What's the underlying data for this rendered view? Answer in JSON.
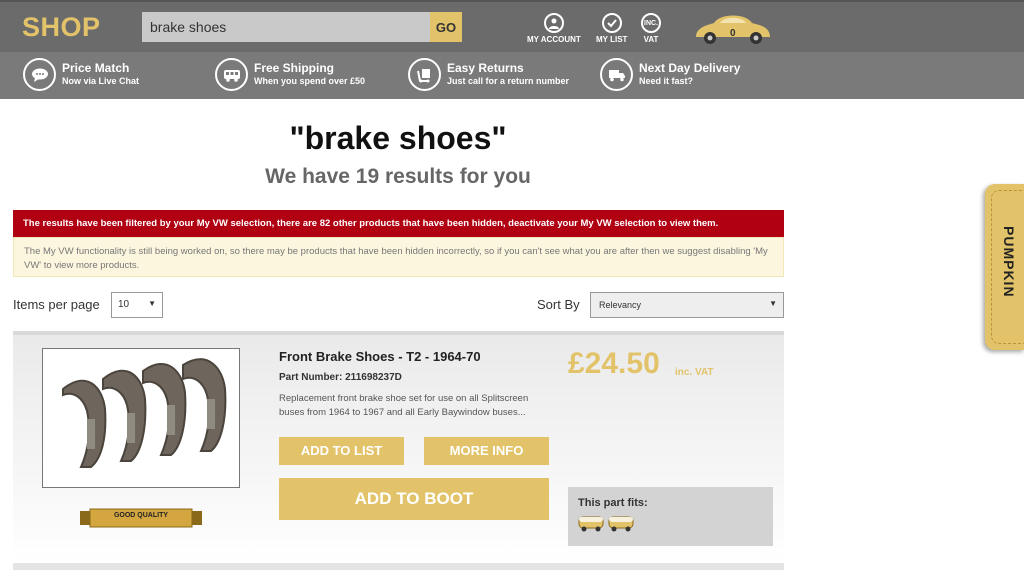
{
  "header": {
    "logo": "SHOP",
    "search_value": "brake shoes",
    "search_button": "GO",
    "my_account": "MY ACCOUNT",
    "my_list": "MY LIST",
    "vat": "VAT",
    "vat_icon_text": "INC.",
    "basket_count": "0"
  },
  "benefits": [
    {
      "title": "Price Match",
      "subtitle": "Now via Live Chat",
      "icon": "chat-icon"
    },
    {
      "title": "Free Shipping",
      "subtitle": "When you spend over £50",
      "icon": "van-icon"
    },
    {
      "title": "Easy Returns",
      "subtitle": "Just call for a return number",
      "icon": "returns-icon"
    },
    {
      "title": "Next Day Delivery",
      "subtitle": "Need it fast?",
      "icon": "truck-icon"
    }
  ],
  "search_results": {
    "query_title": "\"brake shoes\"",
    "summary": "We have 19 results for you"
  },
  "alerts": {
    "filtered": "The results have been filtered by your My VW selection, there are 82 other products that have been hidden, deactivate your My VW selection to view them.",
    "notice": "The My VW functionality is still being worked on, so there may be products that have been hidden incorrectly, so if you can't see what you are after then we suggest disabling 'My VW' to view more products."
  },
  "controls": {
    "items_per_page_label": "Items per page",
    "items_per_page_value": "10",
    "sort_by_label": "Sort By",
    "sort_by_value": "Relevancy"
  },
  "product": {
    "name": "Front Brake Shoes - T2 - 1964-70",
    "part_number": "Part Number: 211698237D",
    "description": "Replacement front brake shoe set for use on all Splitscreen buses from 1964 to 1967 and all Early Baywindow buses...",
    "quality_badge": "GOOD QUALITY",
    "price": "£24.50",
    "vat_note": "inc. VAT",
    "add_to_list": "ADD TO LIST",
    "more_info": "MORE INFO",
    "add_to_boot": "ADD TO BOOT",
    "fits_label": "This part fits:"
  },
  "side_tab": {
    "label": "PUMPKIN"
  },
  "colors": {
    "gold": "#e2c36a",
    "header_bg": "#6b6b6b",
    "alert_red": "#b00012",
    "alert_yellow": "#fcf6de"
  }
}
